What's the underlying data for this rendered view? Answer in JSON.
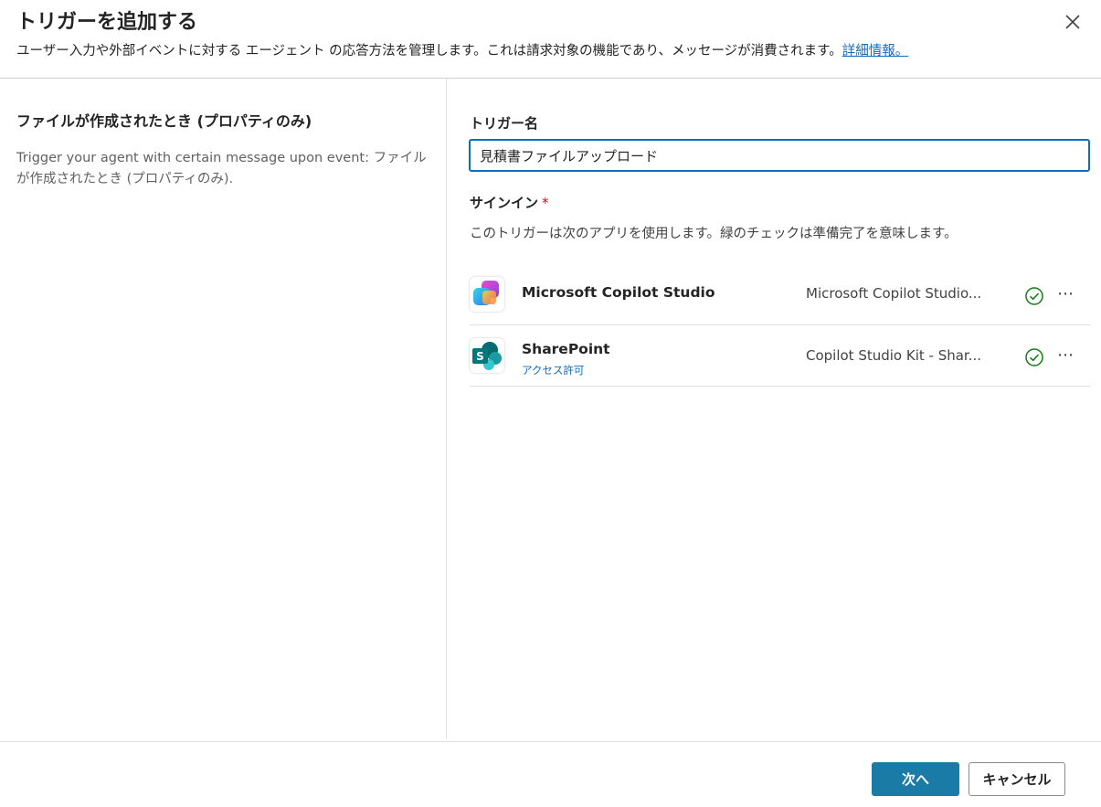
{
  "dialog": {
    "title": "トリガーを追加する",
    "subtitle": "ユーザー入力や外部イベントに対する エージェント の応答方法を管理します。これは請求対象の機能であり、メッセージが消費されます。",
    "learn_more": "詳細情報。",
    "close_icon": "close-icon"
  },
  "left": {
    "trigger_title": "ファイルが作成されたとき (プロパティのみ)",
    "description": "Trigger your agent with certain message upon event: ファイルが作成されたとき (プロパティのみ)."
  },
  "form": {
    "name_label": "トリガー名",
    "name_value": "見積書ファイルアップロード",
    "signin_label": "サインイン",
    "required_mark": "*",
    "signin_description": "このトリガーは次のアプリを使用します。緑のチェックは準備完了を意味します。"
  },
  "connections": [
    {
      "app_name": "Microsoft Copilot Studio",
      "sub_link": "",
      "connection": "Microsoft Copilot Studio...",
      "status_icon": "check-circle-icon",
      "more": "⋯"
    },
    {
      "app_name": "SharePoint",
      "sub_link": "アクセス許可",
      "connection": "Copilot Studio Kit - Shar...",
      "status_icon": "check-circle-icon",
      "more": "⋯"
    }
  ],
  "footer": {
    "next_label": "次へ",
    "cancel_label": "キャンセル"
  },
  "colors": {
    "accent": "#0f6cbd",
    "primary_button": "#1a7ba6",
    "success": "#107c10",
    "required": "#c50f1f"
  }
}
